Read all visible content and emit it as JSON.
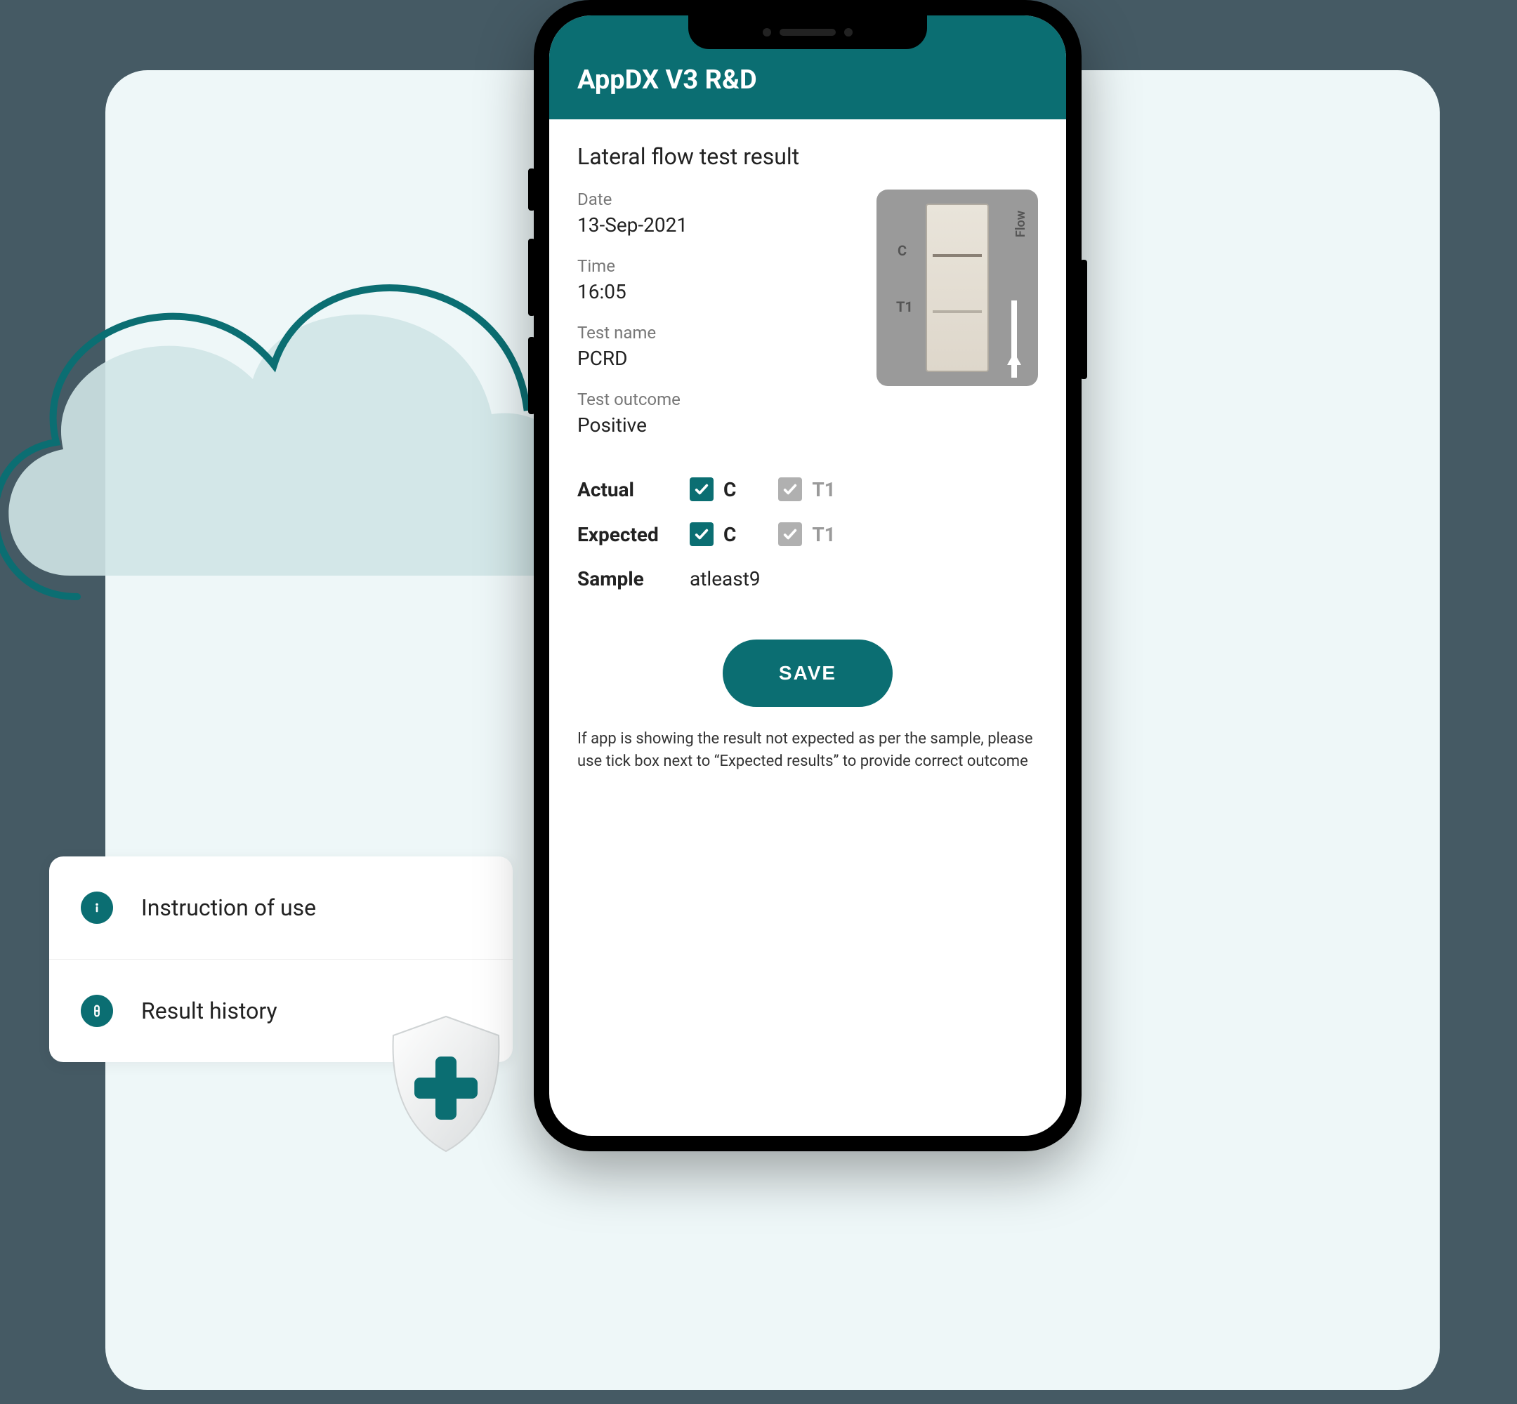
{
  "colors": {
    "teal": "#0b6e72",
    "bg": "#455a64",
    "card": "#eef7f8"
  },
  "menu": {
    "items": [
      {
        "icon": "info-icon",
        "label": "Instruction of use"
      },
      {
        "icon": "vial-icon",
        "label": "Result history"
      }
    ]
  },
  "app": {
    "title": "AppDX V3 R&D",
    "section_title": "Lateral flow test result",
    "fields": {
      "date": {
        "label": "Date",
        "value": "13-Sep-2021"
      },
      "time": {
        "label": "Time",
        "value": "16:05"
      },
      "test_name": {
        "label": "Test name",
        "value": "PCRD"
      },
      "test_outcome": {
        "label": "Test outcome",
        "value": "Positive"
      }
    },
    "test_image": {
      "markers": {
        "c": "C",
        "t1": "T1"
      },
      "flow_label": "Flow"
    },
    "rows": {
      "actual": {
        "label": "Actual",
        "c": {
          "checked": true,
          "label": "C"
        },
        "t1": {
          "checked": true,
          "muted": true,
          "label": "T1"
        }
      },
      "expected": {
        "label": "Expected",
        "c": {
          "checked": true,
          "label": "C"
        },
        "t1": {
          "checked": true,
          "muted": true,
          "label": "T1"
        }
      },
      "sample": {
        "label": "Sample",
        "value": "atleast9"
      }
    },
    "save_label": "SAVE",
    "note": "If app is showing the result not expected as per the sample, please use tick box next to “Expected results” to provide correct outcome"
  }
}
